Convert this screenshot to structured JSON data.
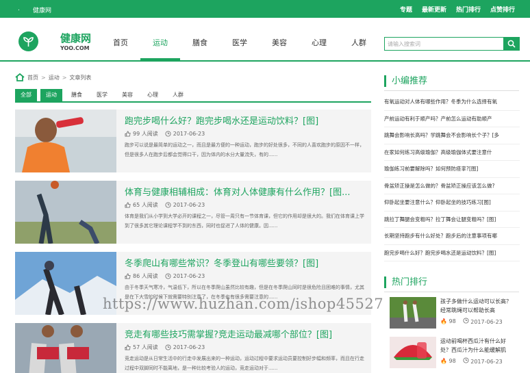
{
  "topbar": {
    "dot": ".",
    "site": "健康网",
    "links": [
      "专题",
      "最新更新",
      "热门排行",
      "点赞排行"
    ]
  },
  "logo": {
    "title": "健康网",
    "sub": "YOO.COM"
  },
  "nav": [
    "首页",
    "运动",
    "膳食",
    "医学",
    "美容",
    "心理",
    "人群"
  ],
  "search": {
    "placeholder": "请输入搜索词"
  },
  "crumb": [
    "首页",
    "运动",
    "文章列表"
  ],
  "filters": [
    "全部",
    "运动",
    "膳食",
    "医学",
    "美容",
    "心理",
    "人群"
  ],
  "articles": [
    {
      "title": "跑完步喝什么好？跑完步喝水还是运动饮料？[图]",
      "reads": "99 人阅读",
      "date": "2017-06-23",
      "desc": "跑步可以说是最简单的运动之一，而且是最方便的一种运动，跑步的好处很多，不同的人喜欢跑步的原因不一样，但是很多人在跑步后都会觉得口干，因为体内的水分大量流失，有的......"
    },
    {
      "title": "体育与健康相辅相成：体育对人体健康有什么作用？[图...",
      "reads": "65 人阅读",
      "date": "2017-06-23",
      "desc": "体育是我们从小学到大学必开的课程之一，尽管一周只有一节体育课，但它的作用却是很大的。我们在体育课上学到了很多其它理论课程学不到的东西，同时也促进了人体的健康。因......"
    },
    {
      "title": "冬季爬山有哪些常识？冬季登山有哪些要领？[图]",
      "reads": "86 人阅读",
      "date": "2017-06-23",
      "desc": "由于冬季天气寒冷，气温低下，所以在冬季爬山虽然比较有趣，但是在冬季爬山同时是很危险且困难的事情，尤其是在下大雪的时候下就需要特别注意了，在冬季也有很多需要注意的......"
    },
    {
      "title": "竞走有哪些技巧需掌握?竞走运动最减哪个部位？[图]",
      "reads": "57 人阅读",
      "date": "2017-06-23",
      "desc": "竞走运动是从日常生活中的行走中发展出来的一种运动，运动过程中要求运动员要控制好步幅和频率，而且在行走过程中双脚同时不能离地，是一种比较考验人的运动，竞走运动对于......"
    }
  ],
  "sidebar": {
    "rec_title": "小编推荐",
    "rec_items": [
      "有氧运动对人体有哪些作用？冬季为什么选择有氧",
      "产前运动有利于顺产吗？产前怎么运动有助顺产",
      "跳舞会影响长高吗？学跳舞会不会影响长个子？[多",
      "在家如何练习高级瑜伽？高级瑜伽体式要注意什",
      "瑜伽练习前要解除吗？如何预防痉挛?[图]",
      "骨盆矫正操是怎么做的？骨盆矫正操应该怎么做?",
      "仰卧起坐要注意什么？仰卧起坐的技巧练习[图]",
      "跳拉丁舞腿会变粗吗？拉丁舞会让腿变粗吗？[图]",
      "长期坚持跑步有什么好处？跑步后的注意事项有哪",
      "跑完步喝什么好？跑完步喝水还是运动饮料？[图]"
    ],
    "hot_title": "热门排行",
    "hot": [
      {
        "title": "孩子多做什么运动可以长高？经常跳绳可以帮助长高",
        "count": "98",
        "date": "2017-06-23"
      },
      {
        "title": "运动前喝杯西瓜汁有什么好处？西瓜汁为什么能缓解肌",
        "count": "98",
        "date": "2017-06-23"
      }
    ]
  },
  "watermark": "https://www.huzhan.com/ishop45527",
  "colors": {
    "brand": "#1da45f",
    "fire": "#e8542a"
  }
}
